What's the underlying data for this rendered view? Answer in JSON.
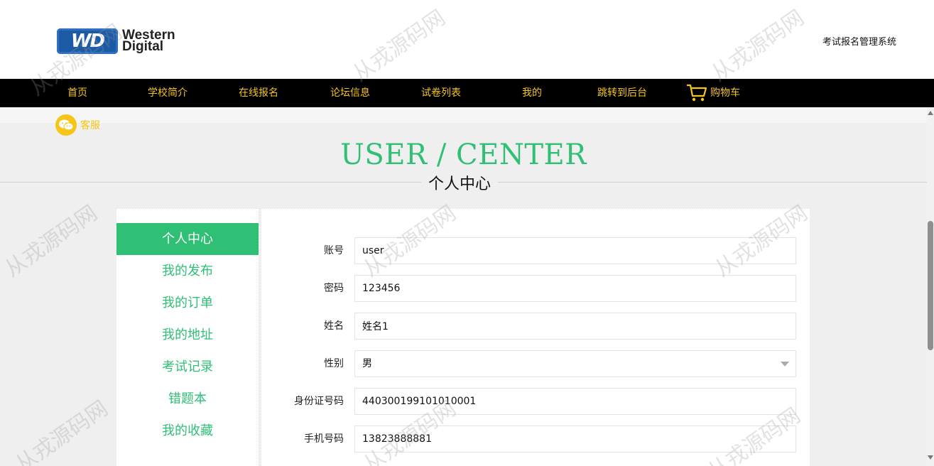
{
  "header": {
    "logo_badge": "WD",
    "logo_line1": "Western",
    "logo_line2": "Digital",
    "site_title": "考试报名管理系统"
  },
  "nav": {
    "items": [
      "首页",
      "学校简介",
      "在线报名",
      "论坛信息",
      "试卷列表",
      "我的",
      "跳转到后台"
    ],
    "cart_label": "购物车"
  },
  "service": {
    "label": "客服"
  },
  "titles": {
    "en": "USER / CENTER",
    "cn": "个人中心"
  },
  "menu": {
    "items": [
      "个人中心",
      "我的发布",
      "我的订单",
      "我的地址",
      "考试记录",
      "错题本",
      "我的收藏"
    ],
    "active_index": 0
  },
  "form": {
    "fields": [
      {
        "label": "账号",
        "value": "user"
      },
      {
        "label": "密码",
        "value": "123456"
      },
      {
        "label": "姓名",
        "value": "姓名1"
      },
      {
        "label": "性别",
        "value": "男"
      },
      {
        "label": "身份证号码",
        "value": "440300199101010001"
      },
      {
        "label": "手机号码",
        "value": "13823888881"
      }
    ]
  },
  "watermark": "从戎源码网",
  "colors": {
    "accent_green": "#2fbf75",
    "nav_bg": "#000000",
    "nav_text": "#f5c518"
  },
  "icons": {
    "cart": "cart-icon",
    "service": "wechat-icon",
    "logo": "wd-logo"
  }
}
